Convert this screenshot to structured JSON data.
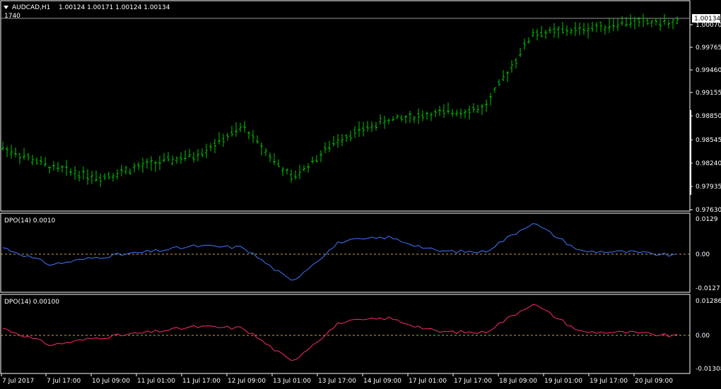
{
  "main": {
    "symbol_title": "AUDCAD,H1",
    "ohlc": "1.00124 1.00171 1.00124 1.00134",
    "volume_label": "1740",
    "current_price": "1.00134",
    "price_ticks": [
      "1.00070",
      "0.99765",
      "0.99460",
      "0.99155",
      "0.98850",
      "0.98545",
      "0.98240",
      "0.97935",
      "0.97630"
    ]
  },
  "indicator_blue": {
    "title": "DPO(14) 0.0010",
    "ticks": [
      "0.0129",
      "0.00",
      "-0.0127"
    ]
  },
  "indicator_red": {
    "title": "DPO(14) 0.00100",
    "ticks": [
      "0.01286",
      "0.00",
      "-0.01308"
    ]
  },
  "time_axis": {
    "labels": [
      "7 Jul 2017",
      "7 Jul 17:00",
      "10 Jul 09:00",
      "11 Jul 01:00",
      "11 Jul 17:00",
      "12 Jul 09:00",
      "13 Jul 01:00",
      "13 Jul 17:00",
      "14 Jul 09:00",
      "17 Jul 01:00",
      "17 Jul 17:00",
      "18 Jul 09:00",
      "19 Jul 01:00",
      "19 Jul 17:00",
      "20 Jul 09:00"
    ]
  },
  "colors": {
    "background": "#000000",
    "candle": "#00c800",
    "dpo_blue": "#3c78ff",
    "dpo_red": "#ff2a6a",
    "axis": "#ffffff",
    "zero_line": "#c8a050"
  },
  "chart_data": [
    {
      "type": "line",
      "title": "AUDCAD,H1",
      "ylim": [
        0.976,
        1.0024
      ],
      "x": [
        "7 Jul 2017",
        "7 Jul 17:00",
        "10 Jul 09:00",
        "11 Jul 01:00",
        "11 Jul 17:00",
        "12 Jul 09:00",
        "13 Jul 01:00",
        "13 Jul 17:00",
        "14 Jul 09:00",
        "17 Jul 01:00",
        "17 Jul 17:00",
        "18 Jul 09:00",
        "19 Jul 01:00",
        "19 Jul 17:00",
        "20 Jul 09:00"
      ],
      "series": [
        {
          "values": [
            0.984,
            0.9815,
            0.9802,
            0.9818,
            0.983,
            0.9866,
            0.98,
            0.9852,
            0.9875,
            0.9883,
            0.989,
            0.9985,
            0.999,
            1.0,
            0.9998
          ]
        }
      ]
    },
    {
      "type": "line",
      "title": "DPO(14) 0.0010",
      "ylim": [
        -0.0127,
        0.0129
      ],
      "series": [
        {
          "values": [
            0.002,
            -0.0038,
            -0.0012,
            0.0005,
            0.0025,
            0.002,
            -0.0095,
            0.004,
            0.0055,
            0.0008,
            0.0005,
            0.0105,
            0.0007,
            0.0005,
            -0.0008
          ]
        }
      ]
    },
    {
      "type": "line",
      "title": "DPO(14) 0.00100",
      "ylim": [
        -0.01308,
        0.01286
      ],
      "series": [
        {
          "values": [
            0.002,
            -0.0038,
            -0.0012,
            0.0005,
            0.0025,
            0.002,
            -0.0095,
            0.004,
            0.0055,
            0.0008,
            0.0005,
            0.0105,
            0.0007,
            0.0005,
            -0.0008
          ]
        }
      ]
    }
  ]
}
